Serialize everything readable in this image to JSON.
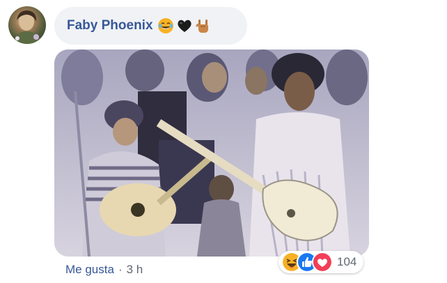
{
  "comment": {
    "author": "Faby Phoenix",
    "author_emojis": [
      "laughing-crying-emoji",
      "black-heart-emoji",
      "rock-hand-emoji"
    ],
    "like_label": "Me gusta",
    "separator": "·",
    "time": "3 h"
  },
  "reactions": {
    "types": [
      "haha-reaction",
      "like-reaction",
      "love-reaction"
    ],
    "count": "104"
  },
  "colors": {
    "name": "#385898",
    "bubble": "#f0f2f5",
    "meta_gray": "#606770",
    "like_blue": "#1877f2",
    "love_red": "#f33e58",
    "haha_yellow": "#f7b125"
  }
}
